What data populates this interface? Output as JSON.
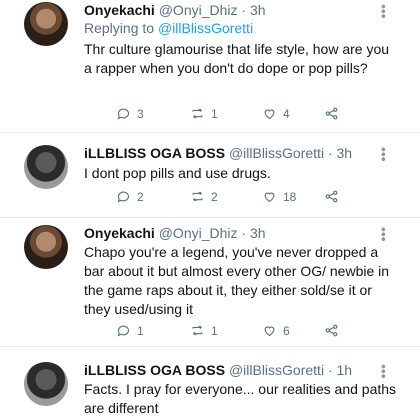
{
  "tweets": [
    {
      "name": "Onyekachi",
      "handle": "@Onyi_Dhiz",
      "time": "· 3h",
      "replying_prefix": "Replying to",
      "replying_handle": "@illBlissGoretti",
      "text": "Thr culture glamourise that life style, how are you a rapper when you don't do dope or pop pills?",
      "comments": "3",
      "retweets": "1",
      "likes": "4"
    },
    {
      "name": "iLLBLISS OGA BOSS",
      "handle": "@illBlissGoretti",
      "time": "· 3h",
      "text": "I dont pop pills and use drugs.",
      "comments": "2",
      "retweets": "2",
      "likes": "18"
    },
    {
      "name": "Onyekachi",
      "handle": "@Onyi_Dhiz",
      "time": "· 3h",
      "text": "Chapo you're a legend, you've never dropped a bar about it but almost every other OG/ newbie in the game raps about it, they either sold/se  it or they used/using it",
      "comments": "1",
      "retweets": "1",
      "likes": "6"
    },
    {
      "name": "iLLBLISS OGA BOSS",
      "handle": "@illBlissGoretti",
      "time": "· 1h",
      "text": "Facts. I pray for everyone... our realities and paths are different"
    }
  ]
}
